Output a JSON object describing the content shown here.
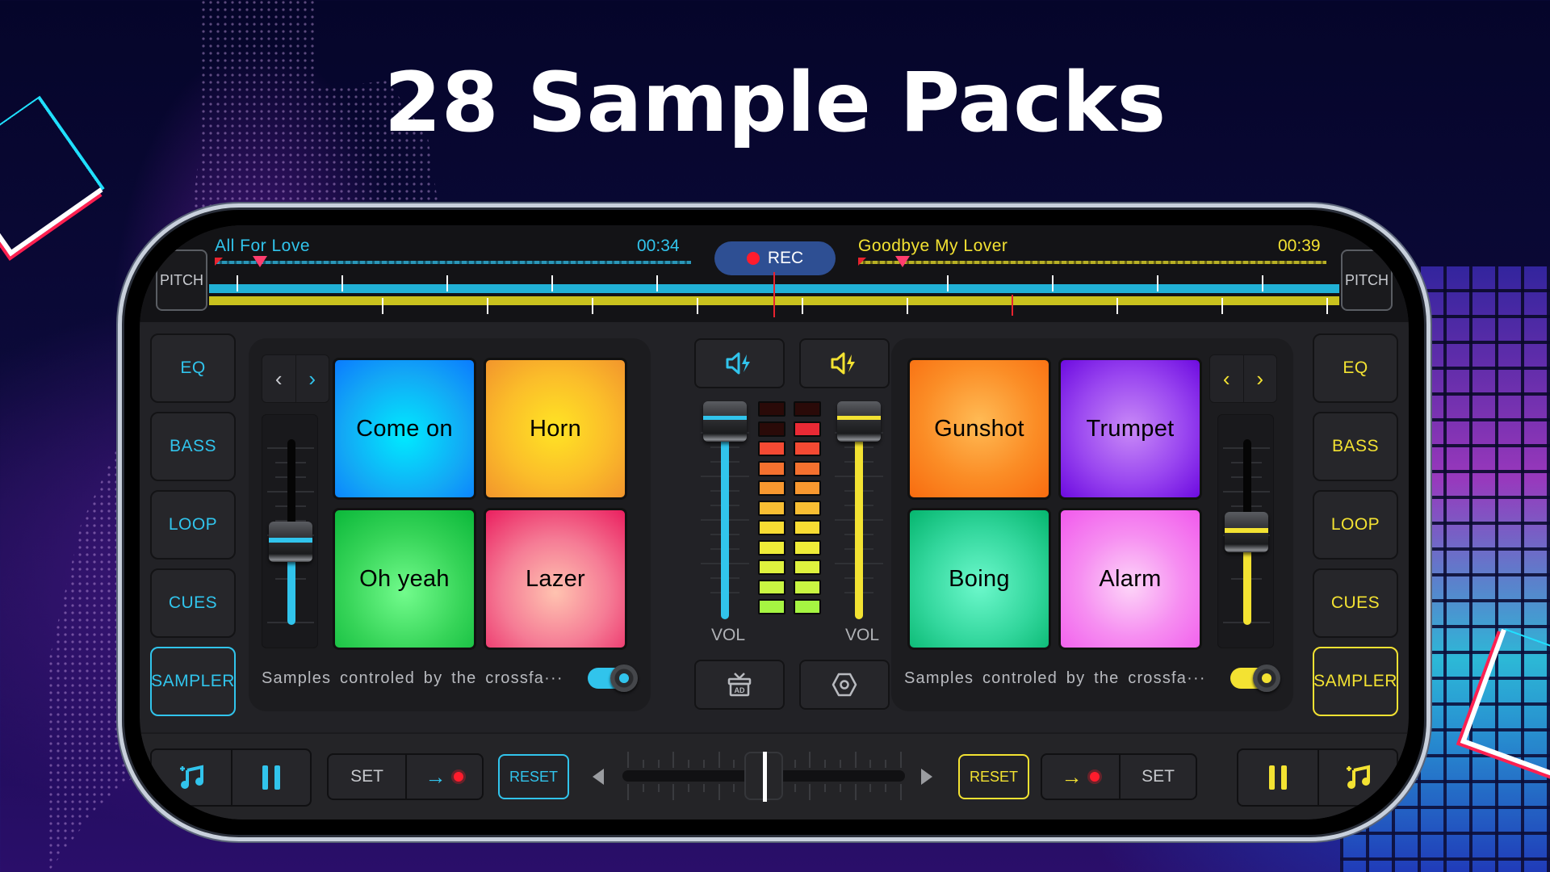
{
  "headline": "28 Sample Packs",
  "colors": {
    "deck_a": "#31c4ec",
    "deck_b": "#f3e232",
    "rec_red": "#ff1c2c",
    "rec_bg": "#2e4f93"
  },
  "top_bar": {
    "pitch_left_label": "PITCH",
    "pitch_right_label": "PITCH",
    "rec_label": "REC",
    "deck_a": {
      "title": "All For Love",
      "time": "00:34"
    },
    "deck_b": {
      "title": "Goodbye My Lover",
      "time": "00:39"
    }
  },
  "deck_a": {
    "side_buttons": [
      "EQ",
      "BASS",
      "LOOP",
      "CUES",
      "SAMPLER"
    ],
    "active_button": "SAMPLER",
    "nav_prev_icon": "chevron-left-icon",
    "nav_next_icon": "chevron-right-icon",
    "sampler_volume": 0.45,
    "pads": [
      {
        "label": "Come on",
        "color": "#13b8f0"
      },
      {
        "label": "Horn",
        "color": "#f7b724"
      },
      {
        "label": "Oh yeah",
        "color": "#2fd25a"
      },
      {
        "label": "Lazer",
        "color": "#ef4f7a"
      }
    ],
    "note": "Samples controled by the crossfa···",
    "toggle_on": true
  },
  "deck_b": {
    "side_buttons": [
      "EQ",
      "BASS",
      "LOOP",
      "CUES",
      "SAMPLER"
    ],
    "active_button": "SAMPLER",
    "nav_prev_icon": "chevron-left-icon",
    "nav_next_icon": "chevron-right-icon",
    "sampler_volume": 0.5,
    "pads": [
      {
        "label": "Gunshot",
        "color": "#fb8a1e"
      },
      {
        "label": "Trumpet",
        "color": "#9b3cf2"
      },
      {
        "label": "Boing",
        "color": "#2fd59b"
      },
      {
        "label": "Alarm",
        "color": "#f47af0"
      }
    ],
    "note": "Samples controled by the crossfa···",
    "toggle_on": true
  },
  "mixer": {
    "vol_label_a": "VOL",
    "vol_label_b": "VOL",
    "volume_a": 1.0,
    "volume_b": 1.0,
    "meter_levels": {
      "left_lit": 9,
      "right_lit": 10,
      "total": 11
    },
    "icons": [
      "speaker-boost-icon",
      "speaker-boost-icon",
      "tv-ad-icon",
      "settings-hexagon-icon"
    ]
  },
  "bottom_bar": {
    "deck_a": {
      "set_label": "SET",
      "reset_label": "RESET"
    },
    "deck_b": {
      "set_label": "SET",
      "reset_label": "RESET"
    },
    "crossfader_position": 0.5
  }
}
